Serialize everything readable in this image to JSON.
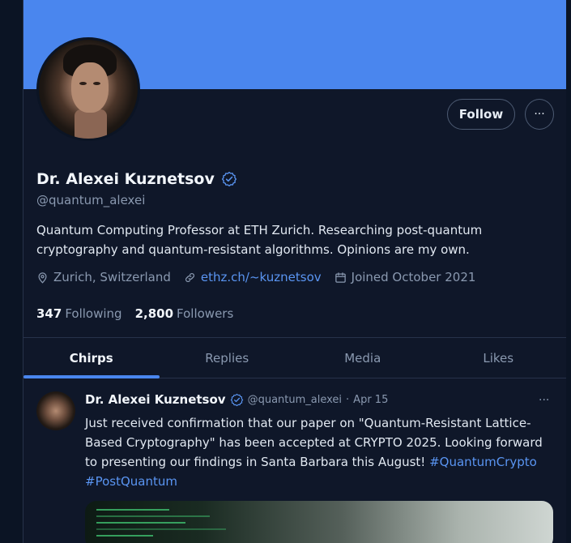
{
  "profile": {
    "name": "Dr. Alexei Kuznetsov",
    "handle": "@quantum_alexei",
    "bio": "Quantum Computing Professor at ETH Zurich. Researching post-quantum cryptography and quantum-resistant algorithms. Opinions are my own.",
    "location": "Zurich, Switzerland",
    "website": "ethz.ch/~kuznetsov",
    "joined": "Joined October 2021",
    "following_count": "347",
    "following_label": "Following",
    "followers_count": "2,800",
    "followers_label": "Followers"
  },
  "actions": {
    "follow_label": "Follow",
    "more_label": "···"
  },
  "tabs": [
    {
      "label": "Chirps",
      "active": true
    },
    {
      "label": "Replies",
      "active": false
    },
    {
      "label": "Media",
      "active": false
    },
    {
      "label": "Likes",
      "active": false
    }
  ],
  "post": {
    "author_name": "Dr. Alexei Kuznetsov",
    "author_handle": "@quantum_alexei",
    "separator": "·",
    "date": "Apr 15",
    "text": "Just received confirmation that our paper on \"Quantum-Resistant Lattice-Based Cryptography\" has been accepted at CRYPTO 2025. Looking forward to presenting our findings in Santa Barbara this August!",
    "hashtag_1": "#QuantumCrypto",
    "hashtag_2": "#PostQuantum",
    "more_label": "···"
  },
  "icons": {
    "verified": "verified-badge-icon",
    "location": "map-pin-icon",
    "link": "link-icon",
    "calendar": "calendar-icon"
  },
  "colors": {
    "banner": "#4a86ee",
    "accent": "#5a95f2",
    "background": "#0f1729"
  }
}
